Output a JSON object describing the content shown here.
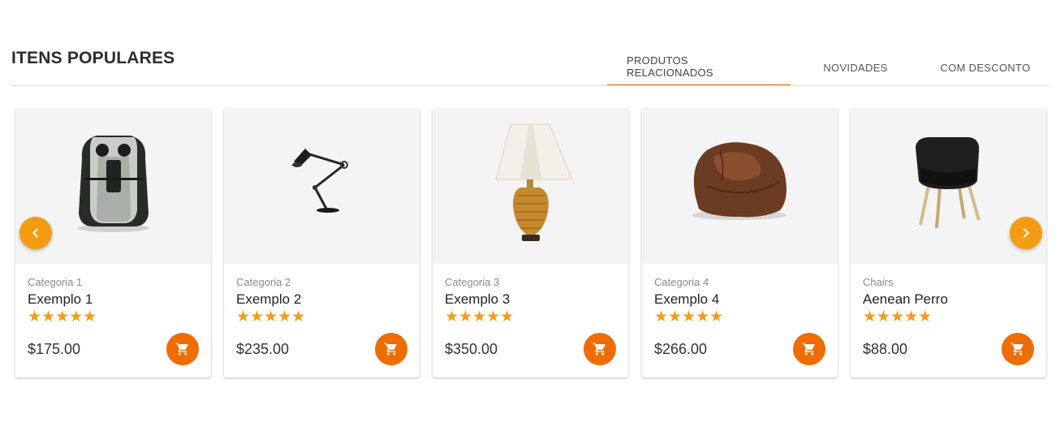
{
  "section": {
    "title": "ITENS POPULARES"
  },
  "tabs": [
    {
      "label": "PRODUTOS RELACIONADOS",
      "active": true
    },
    {
      "label": "NOVIDADES",
      "active": false
    },
    {
      "label": "COM DESCONTO",
      "active": false
    }
  ],
  "products": [
    {
      "category": "Categoria 1",
      "name": "Exemplo 1",
      "rating": 5,
      "stars": "★★★★★",
      "price": "$175.00",
      "image": "air-fryer"
    },
    {
      "category": "Categoria 2",
      "name": "Exemplo 2",
      "rating": 5,
      "stars": "★★★★★",
      "price": "$235.00",
      "image": "desk-lamp"
    },
    {
      "category": "Categoria 3",
      "name": "Exemplo 3",
      "rating": 5,
      "stars": "★★★★★",
      "price": "$350.00",
      "image": "table-lamp"
    },
    {
      "category": "Categoria 4",
      "name": "Exemplo 4",
      "rating": 5,
      "stars": "★★★★★",
      "price": "$266.00",
      "image": "bean-bag"
    },
    {
      "category": "Chairs",
      "name": "Aenean Perro",
      "rating": 5,
      "stars": "★★★★★",
      "price": "$88.00",
      "image": "chair"
    }
  ],
  "icons": {
    "cart": "cart-icon",
    "prev": "chevron-left-icon",
    "next": "chevron-right-icon"
  },
  "colors": {
    "accent": "#ef6c00",
    "nav": "#f39c12",
    "star": "#f39c12"
  }
}
